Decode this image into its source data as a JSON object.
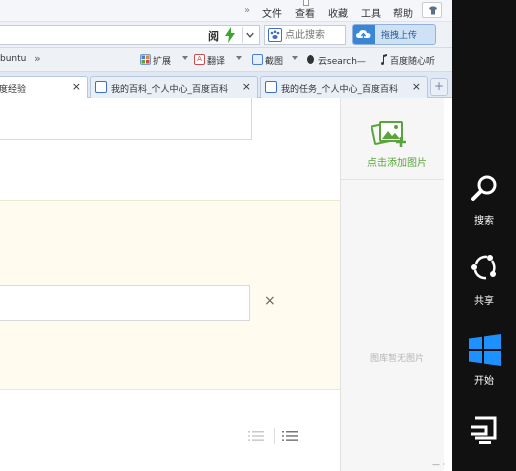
{
  "menu": {
    "more": "»",
    "items": [
      "文件",
      "查看",
      "收藏",
      "工具",
      "帮助"
    ]
  },
  "address_bar": {
    "reader_label": "阅"
  },
  "search": {
    "placeholder": "点此搜索"
  },
  "upload_button": {
    "label": "拖拽上传"
  },
  "bookmarks": {
    "items": [
      "buntu",
      "»",
      "扩展",
      "翻译",
      "截图",
      "云search—",
      "百度随心听"
    ]
  },
  "tabs": [
    {
      "label": "度经验",
      "active": true
    },
    {
      "label": "我的百科_个人中心_百度百科",
      "active": false
    },
    {
      "label": "我的任务_个人中心_百度百科",
      "active": false
    }
  ],
  "tab_close": "×",
  "new_tab": "+",
  "content": {
    "delete_glyph": "×"
  },
  "image_panel": {
    "add_label": "点击添加图片",
    "empty_label": "图库暂无图片"
  },
  "charms": [
    {
      "label": "搜索",
      "icon": "search-icon"
    },
    {
      "label": "共享",
      "icon": "share-icon"
    },
    {
      "label": "开始",
      "icon": "windows-logo-icon"
    },
    {
      "label": "",
      "icon": "devices-icon"
    }
  ],
  "colors": {
    "charms_bg": "#111111",
    "windows_blue": "#1e90ff",
    "add_green": "#5aa53b",
    "tip_bg": "#fffcef"
  }
}
